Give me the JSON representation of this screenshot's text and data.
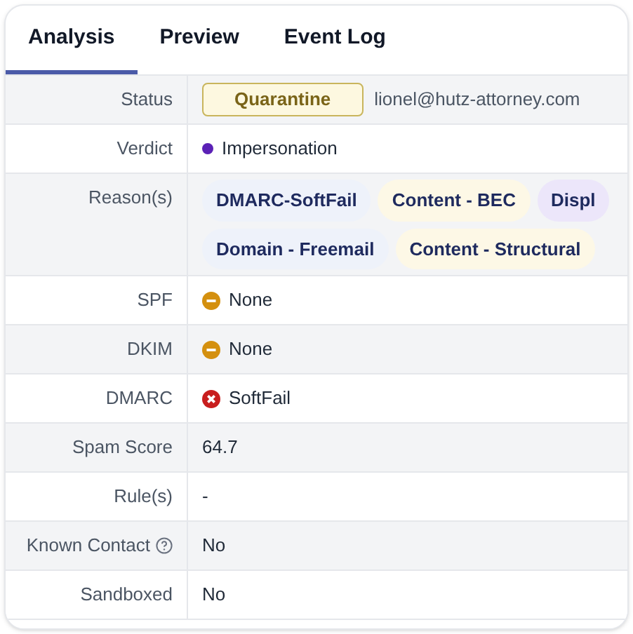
{
  "tabs": [
    {
      "label": "Analysis",
      "selected": true
    },
    {
      "label": "Preview",
      "selected": false
    },
    {
      "label": "Event Log",
      "selected": false
    }
  ],
  "rows": [
    {
      "label": "Status",
      "kind": "status",
      "badge": "Quarantine",
      "value": "lionel@hutz-attorney.com"
    },
    {
      "label": "Verdict",
      "kind": "verdict",
      "value": "Impersonation",
      "color": "#5b21b6"
    },
    {
      "label": "Reason(s)",
      "kind": "tags",
      "tags": [
        {
          "text": "DMARC-SoftFail",
          "color": "#eef2fa"
        },
        {
          "text": "Content - BEC",
          "color": "#fdf8e6"
        },
        {
          "text": "Displ",
          "color": "#ece6fa"
        },
        {
          "text": "Domain - Freemail",
          "color": "#eef2fa"
        },
        {
          "text": "Content - Structural",
          "color": "#fdf8e6"
        }
      ]
    },
    {
      "label": "SPF",
      "kind": "neutral",
      "value": "None"
    },
    {
      "label": "DKIM",
      "kind": "neutral",
      "value": "None"
    },
    {
      "label": "DMARC",
      "kind": "failed",
      "value": "SoftFail"
    },
    {
      "label": "Spam Score",
      "kind": "text",
      "value": "64.7"
    },
    {
      "label": "Rule(s)",
      "kind": "text",
      "value": "-"
    },
    {
      "label": "Known Contact",
      "kind": "text",
      "help": true,
      "value": "No"
    },
    {
      "label": "Sandboxed",
      "kind": "text",
      "value": "No"
    }
  ]
}
